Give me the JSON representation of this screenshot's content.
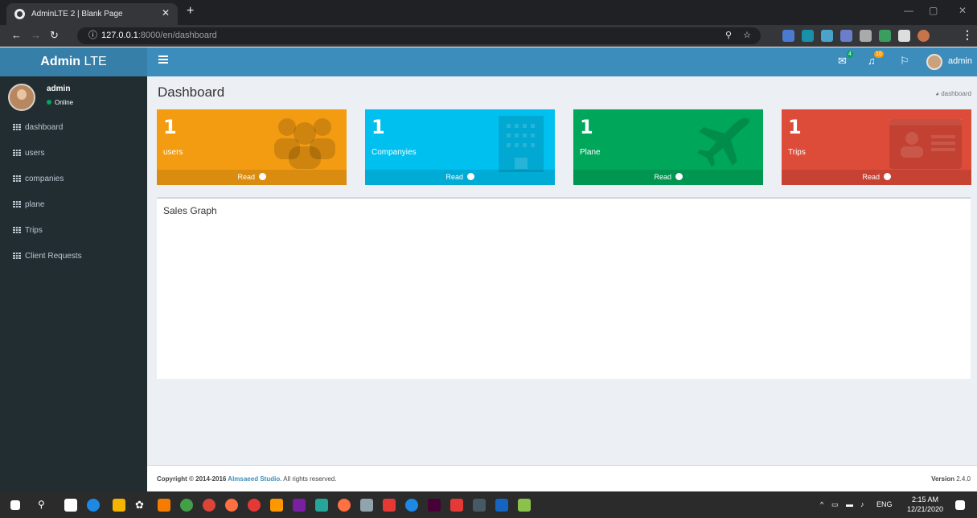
{
  "browser": {
    "tab_title": "AdminLTE 2 | Blank Page",
    "url_host": "127.0.0.1",
    "url_path": ":8000/en/dashboard"
  },
  "header": {
    "logo_bold": "Admin",
    "logo_rest": " LTE",
    "mail_badge": "4",
    "notif_badge": "10",
    "user_name": "admin"
  },
  "sidebar": {
    "user_name": "admin",
    "user_status": "Online",
    "items": [
      {
        "label": "dashboard"
      },
      {
        "label": "users"
      },
      {
        "label": "companies"
      },
      {
        "label": "plane"
      },
      {
        "label": "Trips"
      },
      {
        "label": "Client Requests"
      }
    ]
  },
  "content": {
    "page_title": "Dashboard",
    "breadcrumb": "dashboard",
    "boxes": [
      {
        "value": "1",
        "label": "users",
        "link": "Read",
        "color": "#f39c12",
        "icon": "users-icon"
      },
      {
        "value": "1",
        "label": "Companyies",
        "link": "Read",
        "color": "#00c0ef",
        "icon": "building-icon"
      },
      {
        "value": "1",
        "label": "Plane",
        "link": "Read",
        "color": "#00a65a",
        "icon": "plane-icon"
      },
      {
        "value": "1",
        "label": "Trips",
        "link": "Read",
        "color": "#dd4b39",
        "icon": "id-card-icon"
      }
    ],
    "sales_title": "Sales Graph"
  },
  "footer": {
    "copyright_prefix": "Copyright © 2014-2016 ",
    "copyright_link": "Almsaeed Studio.",
    "copyright_suffix": " All rights reserved.",
    "version_label": "Version",
    "version_value": " 2.4.0"
  },
  "taskbar": {
    "lang": "ENG",
    "time": "2:15 AM",
    "date": "12/21/2020"
  }
}
